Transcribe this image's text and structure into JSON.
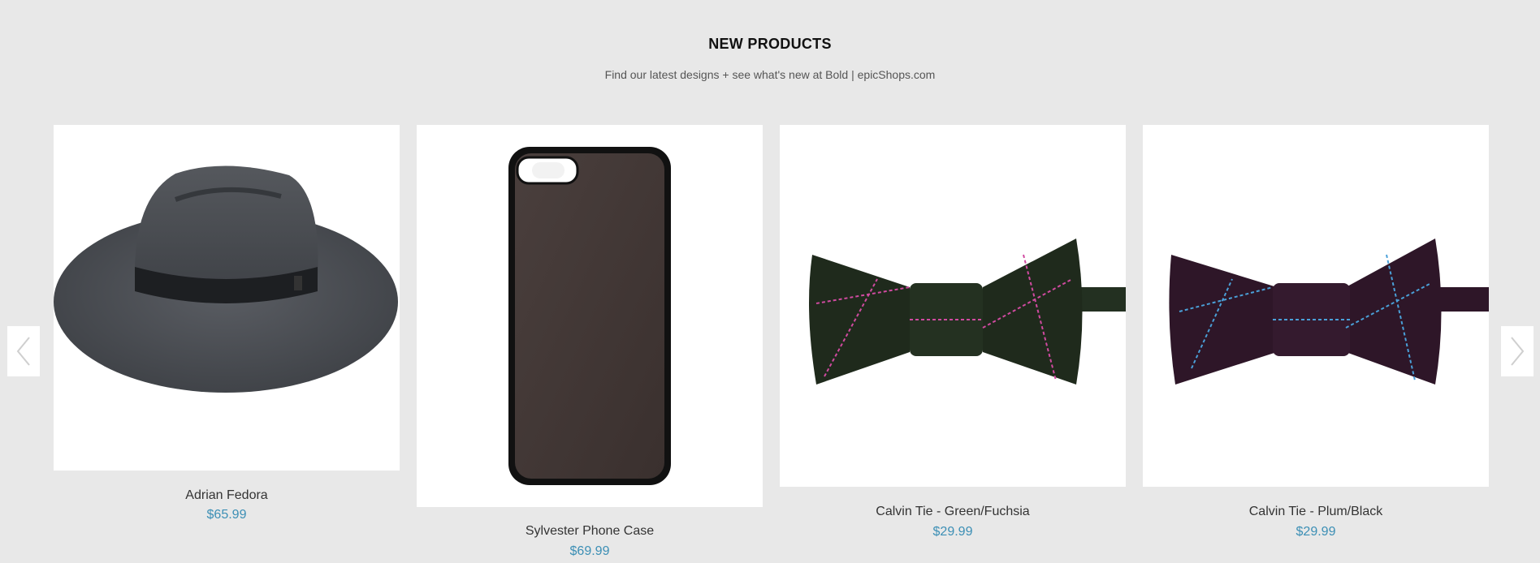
{
  "section": {
    "title": "NEW PRODUCTS",
    "subtitle": "Find our latest designs + see what's new at Bold | epicShops.com"
  },
  "carousel": {
    "prev_icon": "chevron-left-icon",
    "next_icon": "chevron-right-icon"
  },
  "products": [
    {
      "name": "Adrian Fedora",
      "price": "$65.99",
      "image": "fedora-hat"
    },
    {
      "name": "Sylvester Phone Case",
      "price": "$69.99",
      "image": "phone-case"
    },
    {
      "name": "Calvin Tie - Green/Fuchsia",
      "price": "$29.99",
      "image": "bow-tie-green"
    },
    {
      "name": "Calvin Tie - Plum/Black",
      "price": "$29.99",
      "image": "bow-tie-plum"
    }
  ],
  "colors": {
    "background": "#e8e8e8",
    "price": "#3c8fb5",
    "bowtie_green_base": "#1f2a1c",
    "bowtie_green_stripe": "#d04aa0",
    "bowtie_plum_base": "#2e1628",
    "bowtie_plum_stripe": "#4aa0d8"
  }
}
